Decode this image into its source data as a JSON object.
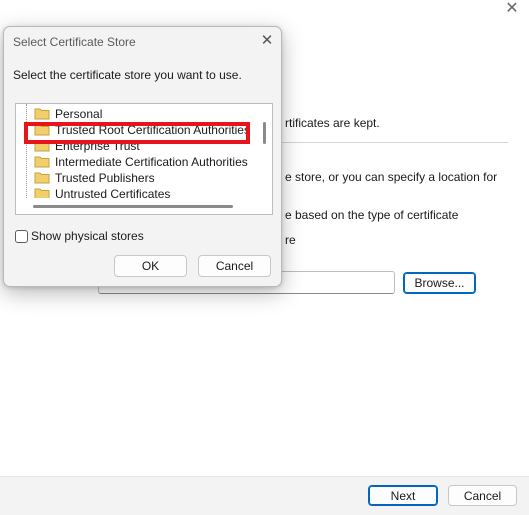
{
  "wizard": {
    "close_glyph": "✕",
    "text_lines": [
      "rtificates are kept.",
      "e store, or you can specify a location for",
      "e based on the type of certificate",
      "re"
    ],
    "browse_label": "Browse...",
    "next_label": "Next",
    "cancel_label": "Cancel"
  },
  "dialog": {
    "title": "Select Certificate Store",
    "close_glyph": "✕",
    "prompt": "Select the certificate store you want to use.",
    "stores": [
      "Personal",
      "Trusted Root Certification Authorities",
      "Enterprise Trust",
      "Intermediate Certification Authorities",
      "Trusted Publishers",
      "Untrusted Certificates"
    ],
    "selected_store": "Trusted Root Certification Authorities",
    "show_physical_label": "Show physical stores",
    "show_physical_checked": false,
    "ok_label": "OK",
    "cancel_label": "Cancel"
  },
  "colors": {
    "highlight_border": "#e8141c",
    "folder_fill": "#f2cf6a",
    "primary_border": "#0067c0"
  },
  "icons": {
    "store": "folder-icon",
    "close": "close-icon"
  }
}
